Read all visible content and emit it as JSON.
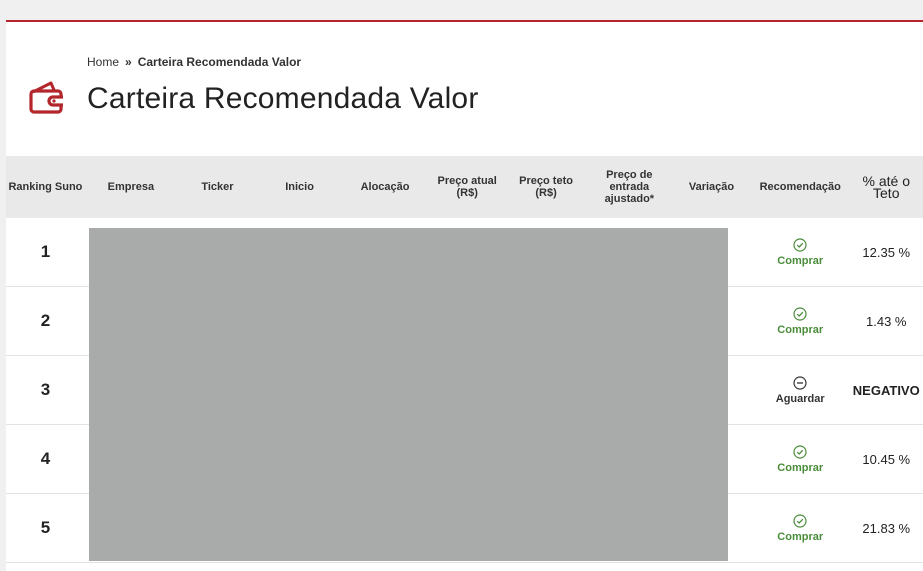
{
  "breadcrumb": {
    "home": "Home",
    "separator": "»",
    "current": "Carteira Recomendada Valor"
  },
  "page": {
    "title": "Carteira Recomendada Valor",
    "icon": "wallet-icon",
    "accent": "#b3262b"
  },
  "table": {
    "headers": {
      "ranking": "Ranking Suno",
      "empresa": "Empresa",
      "ticker": "Ticker",
      "inicio": "Inicio",
      "alocacao": "Alocação",
      "preco_atual": "Preço atual (R$)",
      "preco_teto": "Preço teto (R$)",
      "preco_entrada": "Preço de entrada ajustado*",
      "variacao": "Variação",
      "recomendacao": "Recomendação",
      "ate_teto": "% até o Teto"
    },
    "rows": [
      {
        "rank": "1",
        "rec": "Comprar",
        "rec_icon": "check-circle-icon",
        "pct": "12.35 %"
      },
      {
        "rank": "2",
        "rec": "Comprar",
        "rec_icon": "check-circle-icon",
        "pct": "1.43 %"
      },
      {
        "rank": "3",
        "rec": "Aguardar",
        "rec_icon": "minus-circle-icon",
        "pct": "NEGATIVO"
      },
      {
        "rank": "4",
        "rec": "Comprar",
        "rec_icon": "check-circle-icon",
        "pct": "10.45 %"
      },
      {
        "rank": "5",
        "rec": "Comprar",
        "rec_icon": "check-circle-icon",
        "pct": "21.83 %"
      }
    ]
  },
  "colors": {
    "buy": "#4a8c3a",
    "wait": "#333333",
    "redaction": "#a9aaaa",
    "header_bg": "#e9e9e9"
  }
}
